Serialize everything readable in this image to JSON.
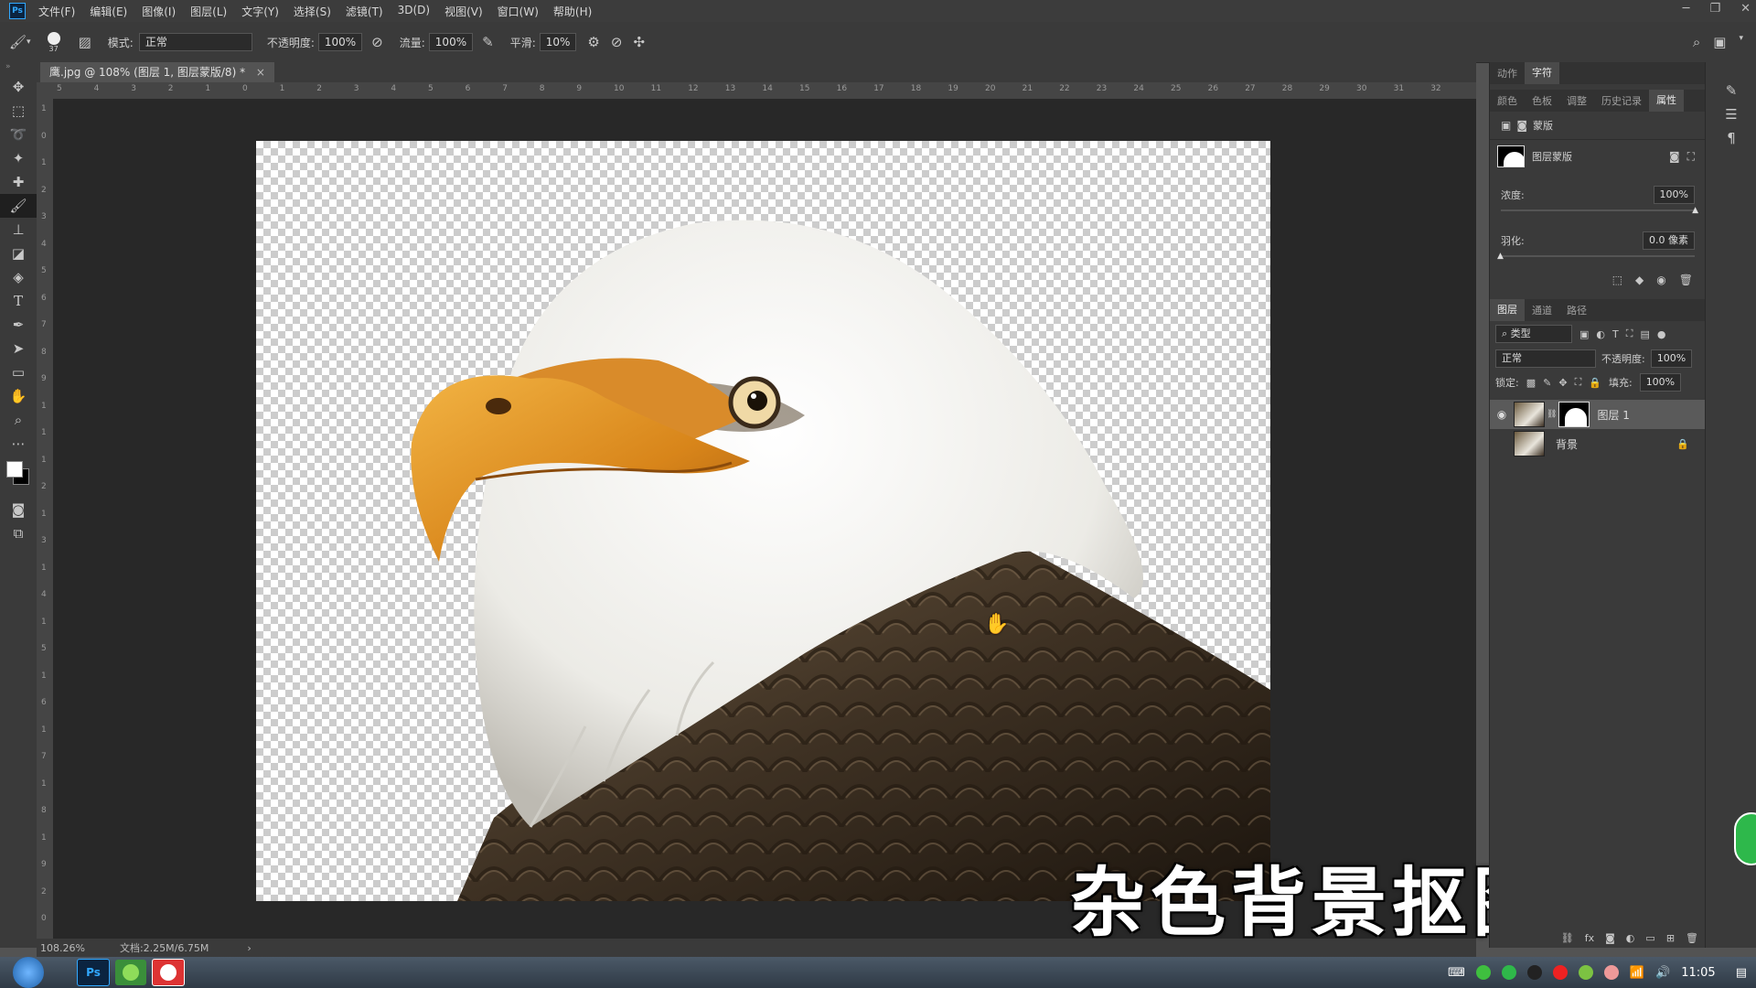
{
  "app": {
    "logo": "Ps"
  },
  "menu": [
    "文件(F)",
    "编辑(E)",
    "图像(I)",
    "图层(L)",
    "文字(Y)",
    "选择(S)",
    "滤镜(T)",
    "3D(D)",
    "视图(V)",
    "窗口(W)",
    "帮助(H)"
  ],
  "options": {
    "brush_size": "37",
    "mode_label": "模式:",
    "mode_value": "正常",
    "opacity_label": "不透明度:",
    "opacity_value": "100%",
    "flow_label": "流量:",
    "flow_value": "100%",
    "smooth_label": "平滑:",
    "smooth_value": "10%"
  },
  "document": {
    "tab_title": "鹰.jpg @ 108% (图层 1, 图层蒙版/8) *",
    "close": "×"
  },
  "ruler_h": [
    "5",
    "4",
    "3",
    "2",
    "1",
    "0",
    "1",
    "2",
    "3",
    "4",
    "5",
    "6",
    "7",
    "8",
    "9",
    "10",
    "11",
    "12",
    "13",
    "14",
    "15",
    "16",
    "17",
    "18",
    "19",
    "20",
    "21",
    "22",
    "23",
    "24",
    "25",
    "26",
    "27",
    "28",
    "29",
    "30",
    "31",
    "32"
  ],
  "ruler_v": [
    "1",
    "0",
    "1",
    "2",
    "3",
    "4",
    "5",
    "6",
    "7",
    "8",
    "9",
    "1",
    "1",
    "1",
    "2",
    "1",
    "3",
    "1",
    "4",
    "1",
    "5",
    "1",
    "6",
    "1",
    "7",
    "1",
    "8",
    "1",
    "9",
    "2",
    "0"
  ],
  "status": {
    "zoom": "108.26%",
    "doc": "文档:2.25M/6.75M",
    "arrow": "›"
  },
  "overlay_text": "杂色背景抠图",
  "panels": {
    "top_tabs": [
      "动作",
      "字符"
    ],
    "second_tabs": [
      "颜色",
      "色板",
      "调整",
      "历史记录",
      "属性"
    ],
    "properties": {
      "title": "蒙版",
      "mask_name": "图层蒙版",
      "density_label": "浓度:",
      "density_value": "100%",
      "feather_label": "羽化:",
      "feather_value": "0.0 像素"
    },
    "layer_tabs": [
      "图层",
      "通道",
      "路径"
    ],
    "filter_label": "类型",
    "blend_mode": "正常",
    "opacity_label": "不透明度:",
    "opacity_value": "100%",
    "lock_label": "锁定:",
    "fill_label": "填充:",
    "fill_value": "100%",
    "layers": [
      {
        "name": "图层 1",
        "visible": true,
        "has_mask": true,
        "selected": true
      },
      {
        "name": "背景",
        "visible": false,
        "locked": true
      }
    ]
  },
  "taskbar": {
    "ps_label": "Ps",
    "time": "11:05"
  },
  "colors": {
    "accent": "#31a8ff",
    "canvas_bg": "#282828",
    "panel_bg": "#3a3a3a"
  }
}
